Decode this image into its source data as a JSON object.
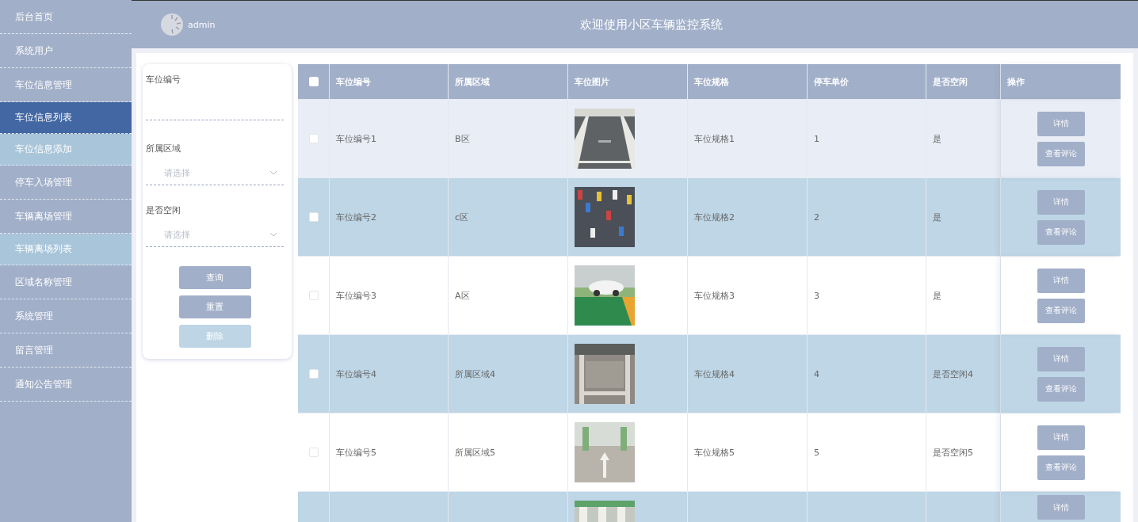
{
  "sidebar": {
    "items": [
      {
        "label": "后台首页",
        "kind": "menu",
        "selected": false
      },
      {
        "label": "系统用户",
        "kind": "menu",
        "selected": false
      },
      {
        "label": "车位信息管理",
        "kind": "menu",
        "selected": false
      },
      {
        "label": "车位信息列表",
        "kind": "sub",
        "selected": true
      },
      {
        "label": "车位信息添加",
        "kind": "sub",
        "selected": false
      },
      {
        "label": "停车入场管理",
        "kind": "menu",
        "selected": false
      },
      {
        "label": "车辆离场管理",
        "kind": "menu",
        "selected": false
      },
      {
        "label": "车辆离场列表",
        "kind": "sub",
        "selected": false
      },
      {
        "label": "区域名称管理",
        "kind": "menu",
        "selected": false
      },
      {
        "label": "系统管理",
        "kind": "menu",
        "selected": false
      },
      {
        "label": "留言管理",
        "kind": "menu",
        "selected": false
      },
      {
        "label": "通知公告管理",
        "kind": "menu",
        "selected": false
      }
    ]
  },
  "header": {
    "user": "admin",
    "title": "欢迎使用小区车辆监控系统"
  },
  "filter": {
    "fields": [
      {
        "label": "车位编号",
        "kind": "text"
      },
      {
        "label": "所属区域",
        "kind": "select",
        "placeholder": "请选择"
      },
      {
        "label": "是否空闲",
        "kind": "select",
        "placeholder": "请选择"
      }
    ],
    "buttons": [
      {
        "label": "查询",
        "disabled": false
      },
      {
        "label": "重置",
        "disabled": false
      },
      {
        "label": "删除",
        "disabled": true
      }
    ]
  },
  "table": {
    "select_all": {
      "checked": false
    },
    "columns": [
      "车位编号",
      "所属区域",
      "车位图片",
      "车位规格",
      "停车单价",
      "是否空闲",
      "操作"
    ],
    "rows": [
      {
        "hovered": true,
        "checked": false,
        "cells": [
          "车位编号1",
          "B区",
          "车位规格1",
          "1",
          "是"
        ],
        "actions": [
          "详情",
          "查看评论"
        ]
      },
      {
        "hovered": false,
        "checked": false,
        "cells": [
          "车位编号2",
          "c区",
          "车位规格2",
          "2",
          "是"
        ],
        "actions": [
          "详情",
          "查看评论"
        ]
      },
      {
        "hovered": false,
        "checked": false,
        "cells": [
          "车位编号3",
          "A区",
          "车位规格3",
          "3",
          "是"
        ],
        "actions": [
          "详情",
          "查看评论"
        ]
      },
      {
        "hovered": false,
        "checked": false,
        "cells": [
          "车位编号4",
          "所属区域4",
          "车位规格4",
          "4",
          "是否空闲4"
        ],
        "actions": [
          "详情",
          "查看评论"
        ]
      },
      {
        "hovered": false,
        "checked": false,
        "cells": [
          "车位编号5",
          "所属区域5",
          "车位规格5",
          "5",
          "是否空闲5"
        ],
        "actions": [
          "详情",
          "查看评论"
        ]
      },
      {
        "hovered": false,
        "actions": [
          "详情"
        ]
      }
    ]
  }
}
